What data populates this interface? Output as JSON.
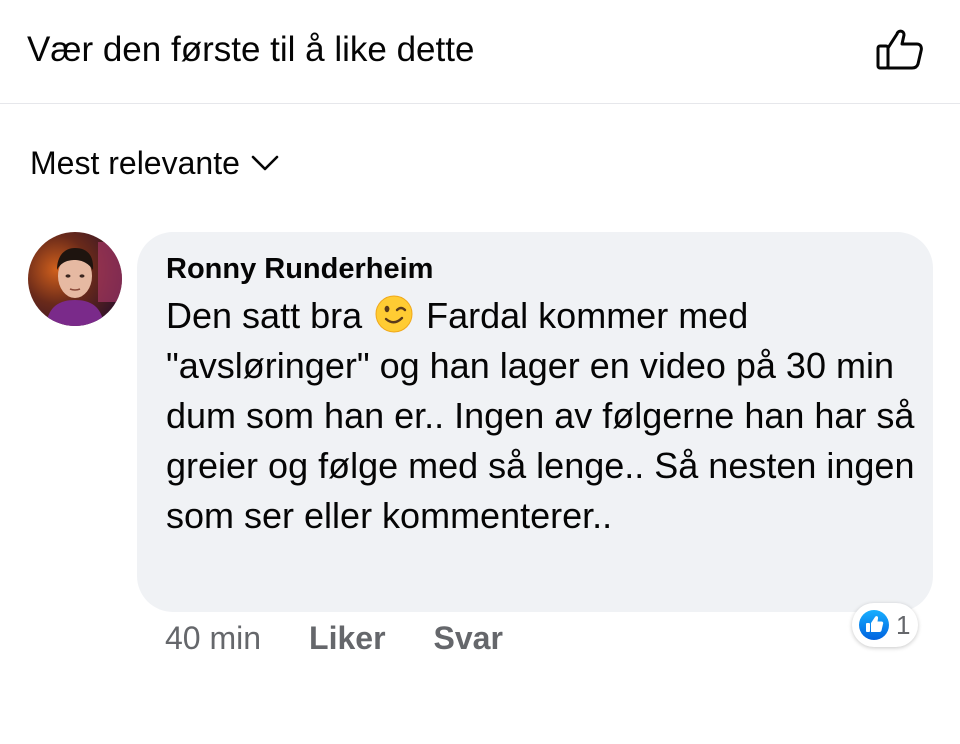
{
  "header": {
    "text": "Vær den første til å like dette",
    "like_icon": "thumbs-up-outline-icon"
  },
  "sort": {
    "label": "Mest relevante",
    "icon": "chevron-down-icon"
  },
  "comment": {
    "author": "Ronny Runderheim",
    "text_before_emoji": "Den satt bra",
    "emoji": "winking-face-emoji",
    "text_after_emoji": "Fardal kommer med \"avsløringer\" og han lager en video på 30 min dum som han er.. Ingen av følgerne han har så greier og følge med så lenge.. Så nesten ingen som ser eller kommenterer..",
    "time": "40 min",
    "like_label": "Liker",
    "reply_label": "Svar",
    "reaction_icon": "like-reaction-icon",
    "reaction_count": "1"
  },
  "colors": {
    "bubble": "#f0f2f5",
    "secondary_text": "#65676b",
    "like_blue": "#1877f2"
  }
}
